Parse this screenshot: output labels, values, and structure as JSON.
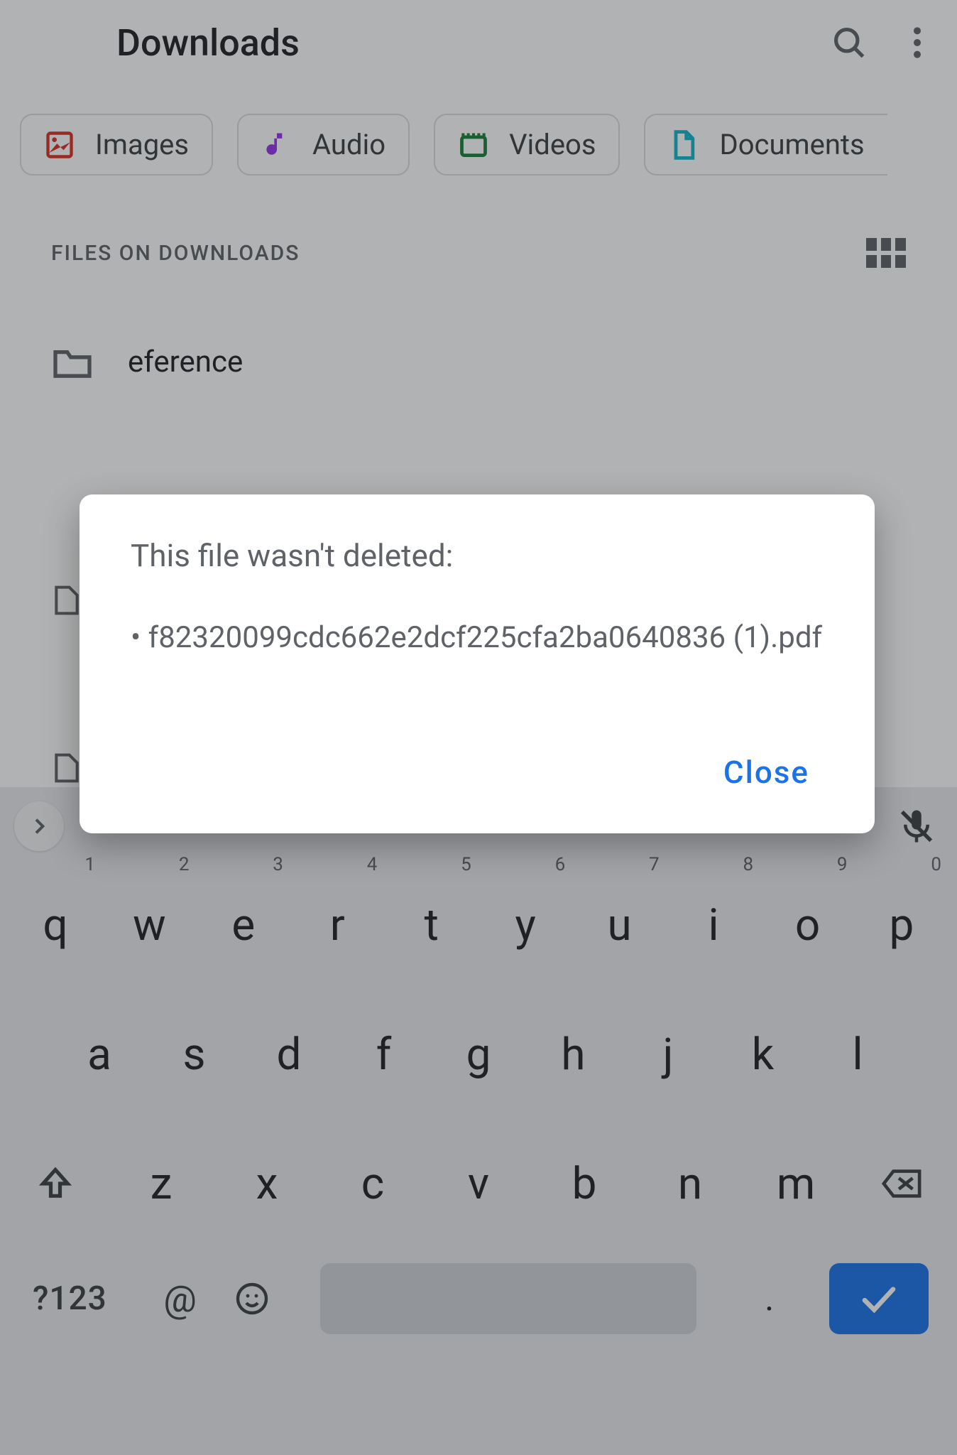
{
  "appbar": {
    "title": "Downloads"
  },
  "chips": [
    {
      "icon": "image-icon",
      "label": "Images",
      "color": "#d93025"
    },
    {
      "icon": "music-icon",
      "label": "Audio",
      "color": "#9334e6"
    },
    {
      "icon": "video-icon",
      "label": "Videos",
      "color": "#188038"
    },
    {
      "icon": "document-icon",
      "label": "Documents",
      "color": "#12b5cb"
    }
  ],
  "section": {
    "label": "FILES ON DOWNLOADS"
  },
  "files": [
    {
      "type": "folder",
      "name": "eference"
    }
  ],
  "dialog": {
    "title": "This file wasn't deleted:",
    "items": [
      "f82320099cdc662e2dcf225cfa2ba0640836 (1).pdf"
    ],
    "close": "Close"
  },
  "keyboard": {
    "row1": [
      {
        "k": "q",
        "s": "1"
      },
      {
        "k": "w",
        "s": "2"
      },
      {
        "k": "e",
        "s": "3"
      },
      {
        "k": "r",
        "s": "4"
      },
      {
        "k": "t",
        "s": "5"
      },
      {
        "k": "y",
        "s": "6"
      },
      {
        "k": "u",
        "s": "7"
      },
      {
        "k": "i",
        "s": "8"
      },
      {
        "k": "o",
        "s": "9"
      },
      {
        "k": "p",
        "s": "0"
      }
    ],
    "row2": [
      "a",
      "s",
      "d",
      "f",
      "g",
      "h",
      "j",
      "k",
      "l"
    ],
    "row3": [
      "z",
      "x",
      "c",
      "v",
      "b",
      "n",
      "m"
    ],
    "symKey": "?123",
    "atKey": "@",
    "dotKey": "."
  }
}
